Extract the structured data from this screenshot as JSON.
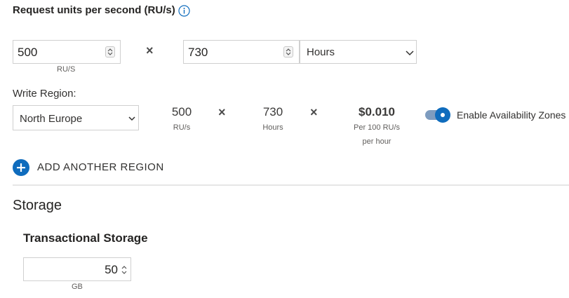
{
  "header": {
    "title": "Request units per second (RU/s)",
    "info_icon": "info-icon"
  },
  "ru_input": {
    "value": "500",
    "unit": "RU/S"
  },
  "multiply_symbol": "×",
  "hours_input": {
    "value": "730"
  },
  "period_select": {
    "selected": "Hours"
  },
  "region": {
    "label": "Write Region:",
    "selected": "North Europe",
    "calc": {
      "ru_value": "500",
      "ru_label": "RU/s",
      "hours_value": "730",
      "hours_label": "Hours",
      "price_value": "$0.010",
      "price_label_1": "Per 100 RU/s",
      "price_label_2": "per hour"
    },
    "availability_zones": {
      "label": "Enable Availability Zones",
      "enabled": true
    }
  },
  "add_region": {
    "label": "ADD ANOTHER REGION"
  },
  "storage": {
    "heading": "Storage",
    "subheading": "Transactional Storage",
    "input_value": "50",
    "unit": "GB"
  },
  "colors": {
    "accent": "#0f6cbd",
    "toggle_track": "#7e9cbf"
  }
}
